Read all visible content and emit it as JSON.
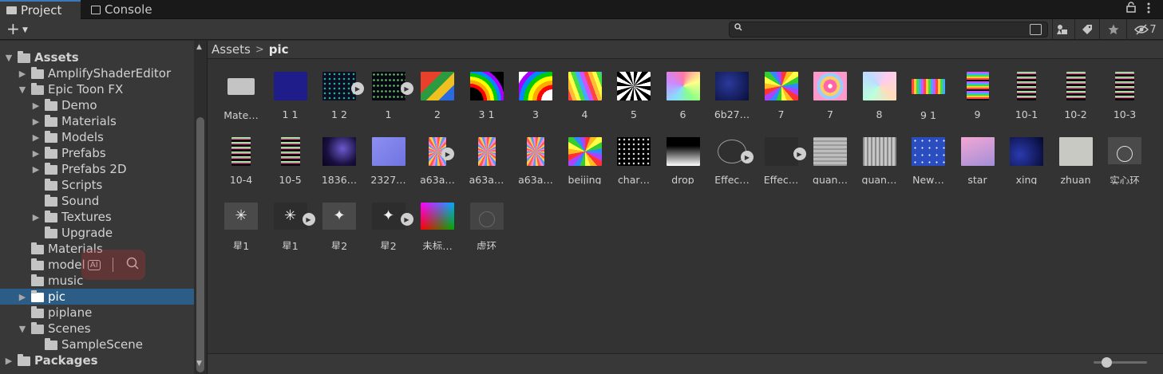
{
  "tabs": [
    {
      "label": "Project",
      "icon": "folder-icon"
    },
    {
      "label": "Console",
      "icon": "console-icon"
    }
  ],
  "window_controls": {
    "lock_icon": "lock-icon",
    "menu_icon": "kebab-menu-icon"
  },
  "toolbar": {
    "add_label": "+",
    "search": {
      "value": "",
      "placeholder": ""
    },
    "hidden_count": "7"
  },
  "tree": [
    {
      "label": "Assets",
      "depth": 0,
      "expanded": true,
      "bold": true
    },
    {
      "label": "AmplifyShaderEditor",
      "depth": 1,
      "expanded": false
    },
    {
      "label": "Epic Toon FX",
      "depth": 1,
      "expanded": true
    },
    {
      "label": "Demo",
      "depth": 2,
      "expanded": false
    },
    {
      "label": "Materials",
      "depth": 2,
      "expanded": false
    },
    {
      "label": "Models",
      "depth": 2,
      "expanded": false
    },
    {
      "label": "Prefabs",
      "depth": 2,
      "expanded": false
    },
    {
      "label": "Prefabs 2D",
      "depth": 2,
      "expanded": false
    },
    {
      "label": "Scripts",
      "depth": 2,
      "leaf": true
    },
    {
      "label": "Sound",
      "depth": 2,
      "leaf": true
    },
    {
      "label": "Textures",
      "depth": 2,
      "expanded": false
    },
    {
      "label": "Upgrade",
      "depth": 2,
      "leaf": true
    },
    {
      "label": "Materials",
      "depth": 1,
      "leaf": true
    },
    {
      "label": "model",
      "depth": 1,
      "leaf": true
    },
    {
      "label": "music",
      "depth": 1,
      "leaf": true
    },
    {
      "label": "pic",
      "depth": 1,
      "expanded": false,
      "selected": true
    },
    {
      "label": "piplane",
      "depth": 1,
      "leaf": true
    },
    {
      "label": "Scenes",
      "depth": 1,
      "expanded": true
    },
    {
      "label": "SampleScene",
      "depth": 2,
      "leaf": true
    },
    {
      "label": "Packages",
      "depth": 0,
      "expanded": false,
      "bold": true
    }
  ],
  "breadcrumb": {
    "root": "Assets",
    "current": "pic"
  },
  "assets": [
    {
      "label": "Mate…",
      "thumb": "folder"
    },
    {
      "label": "1 1",
      "thumb": "navy"
    },
    {
      "label": "1 2",
      "thumb": "dots",
      "play": true
    },
    {
      "label": "1",
      "thumb": "dots2",
      "play": true
    },
    {
      "label": "2",
      "thumb": "color-blocks"
    },
    {
      "label": "3 1",
      "thumb": "rainbow-curve"
    },
    {
      "label": "3",
      "thumb": "rainbow-curve2"
    },
    {
      "label": "4",
      "thumb": "rainbow-waves"
    },
    {
      "label": "5",
      "thumb": "bw-spiral"
    },
    {
      "label": "6",
      "thumb": "pastel-swirl"
    },
    {
      "label": "6b27…",
      "thumb": "space"
    },
    {
      "label": "7",
      "thumb": "rainbow-spiral"
    },
    {
      "label": "7",
      "thumb": "pink-swirl"
    },
    {
      "label": "8",
      "thumb": "pastel-swirl2"
    },
    {
      "label": "9 1",
      "thumb": "rainbow-zigzag-wide"
    },
    {
      "label": "9",
      "thumb": "rainbow-zigzag"
    },
    {
      "label": "10-1",
      "thumb": "zigzag-dark"
    },
    {
      "label": "10-2",
      "thumb": "zigzag-dark"
    },
    {
      "label": "10-3",
      "thumb": "zigzag-dark"
    },
    {
      "label": "10-4",
      "thumb": "zigzag-dark"
    },
    {
      "label": "10-5",
      "thumb": "zigzag-dark"
    },
    {
      "label": "1836…",
      "thumb": "nebula"
    },
    {
      "label": "2327…",
      "thumb": "normal-map"
    },
    {
      "label": "a63a…",
      "thumb": "sunburst",
      "play": true
    },
    {
      "label": "a63a…",
      "thumb": "sunburst"
    },
    {
      "label": "a63a…",
      "thumb": "sunburst"
    },
    {
      "label": "beijing",
      "thumb": "rainbow-spiral"
    },
    {
      "label": "char…",
      "thumb": "dot-grid"
    },
    {
      "label": "drop",
      "thumb": "gradient-bw"
    },
    {
      "label": "Effec…",
      "thumb": "ring",
      "play": true
    },
    {
      "label": "Effec…",
      "thumb": "dark-empty",
      "play": true
    },
    {
      "label": "guan…",
      "thumb": "gray-h"
    },
    {
      "label": "guan…",
      "thumb": "gray-v"
    },
    {
      "label": "New…",
      "thumb": "blue-stars"
    },
    {
      "label": "star",
      "thumb": "pink-gradient"
    },
    {
      "label": "xing",
      "thumb": "space2"
    },
    {
      "label": "zhuan",
      "thumb": "stone"
    },
    {
      "label": "实心环",
      "thumb": "ring-solid"
    },
    {
      "label": "星1",
      "thumb": "sparkle"
    },
    {
      "label": "星1",
      "thumb": "sparkle2",
      "play": true
    },
    {
      "label": "星2",
      "thumb": "sparkle3"
    },
    {
      "label": "星2",
      "thumb": "sparkle4",
      "play": true
    },
    {
      "label": "未标…",
      "thumb": "color-square"
    },
    {
      "label": "虚环",
      "thumb": "ring-faint"
    }
  ]
}
